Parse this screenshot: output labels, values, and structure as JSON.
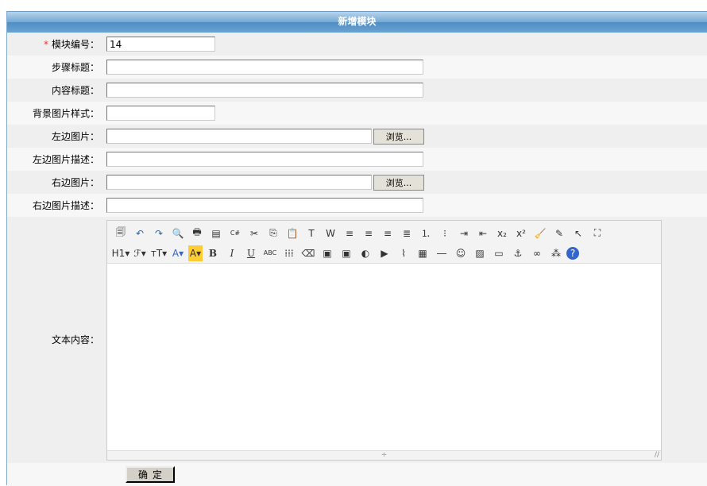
{
  "title": "新增模块",
  "fields": [
    {
      "label": "模块编号：",
      "value": "14",
      "required": "*"
    },
    {
      "label": "步骤标题：",
      "value": ""
    },
    {
      "label": "内容标题：",
      "value": ""
    },
    {
      "label": "背景图片样式：",
      "value": ""
    },
    {
      "label": "左边图片：",
      "value": "",
      "browse": "浏览..."
    },
    {
      "label": "左边图片描述：",
      "value": ""
    },
    {
      "label": "右边图片：",
      "value": "",
      "browse": "浏览..."
    },
    {
      "label": "右边图片描述：",
      "value": ""
    }
  ],
  "editor": {
    "label": "文本内容：",
    "row1": [
      [
        "source",
        "🗐"
      ],
      [
        "undo",
        "↶"
      ],
      [
        "redo",
        "↷"
      ],
      [
        "preview",
        "🔍"
      ],
      [
        "print",
        "🖶"
      ],
      [
        "template",
        "▤"
      ],
      [
        "code",
        "C#"
      ],
      [
        "cut",
        "✂"
      ],
      [
        "copy",
        "⎘"
      ],
      [
        "paste",
        "📋"
      ],
      [
        "paste-text",
        "T"
      ],
      [
        "paste-word",
        "W"
      ],
      [
        "align-left",
        "≡"
      ],
      [
        "align-center",
        "≡"
      ],
      [
        "align-right",
        "≡"
      ],
      [
        "justify",
        "≣"
      ],
      [
        "ordered-list",
        "⒈"
      ],
      [
        "unordered-list",
        "⁝"
      ],
      [
        "indent",
        "⇥"
      ],
      [
        "outdent",
        "⇤"
      ],
      [
        "subscript",
        "x₂"
      ],
      [
        "superscript",
        "x²"
      ],
      [
        "clear-format",
        "🧹"
      ],
      [
        "select-all",
        "✎"
      ],
      [
        "cursor",
        "↖"
      ],
      [
        "fullscreen",
        "⛶"
      ]
    ],
    "row2": [
      [
        "heading",
        "H1▾"
      ],
      [
        "font-family",
        "ℱ▾"
      ],
      [
        "font-size",
        "тT▾"
      ],
      [
        "font-color",
        "A▾"
      ],
      [
        "highlight",
        "A▾"
      ],
      [
        "bold",
        "B"
      ],
      [
        "italic",
        "I"
      ],
      [
        "underline",
        "U"
      ],
      [
        "strikethrough",
        "ABC"
      ],
      [
        "line-height",
        "⁞⁞⁞"
      ],
      [
        "eraser",
        "⌫"
      ],
      [
        "insert-image",
        "▣"
      ],
      [
        "multi-image",
        "▣"
      ],
      [
        "flash",
        "◐"
      ],
      [
        "insert-video",
        "▶"
      ],
      [
        "attachment",
        "⌇"
      ],
      [
        "table",
        "▦"
      ],
      [
        "horizontal-rule",
        "―"
      ],
      [
        "emoticon",
        "☺"
      ],
      [
        "image-gallery",
        "▨"
      ],
      [
        "page-break",
        "▭"
      ],
      [
        "anchor",
        "⚓"
      ],
      [
        "link",
        "∞"
      ],
      [
        "unlink",
        "⁂"
      ],
      [
        "about",
        "?"
      ]
    ],
    "resize_handle": "÷",
    "grip": "//"
  },
  "submit": "确定"
}
